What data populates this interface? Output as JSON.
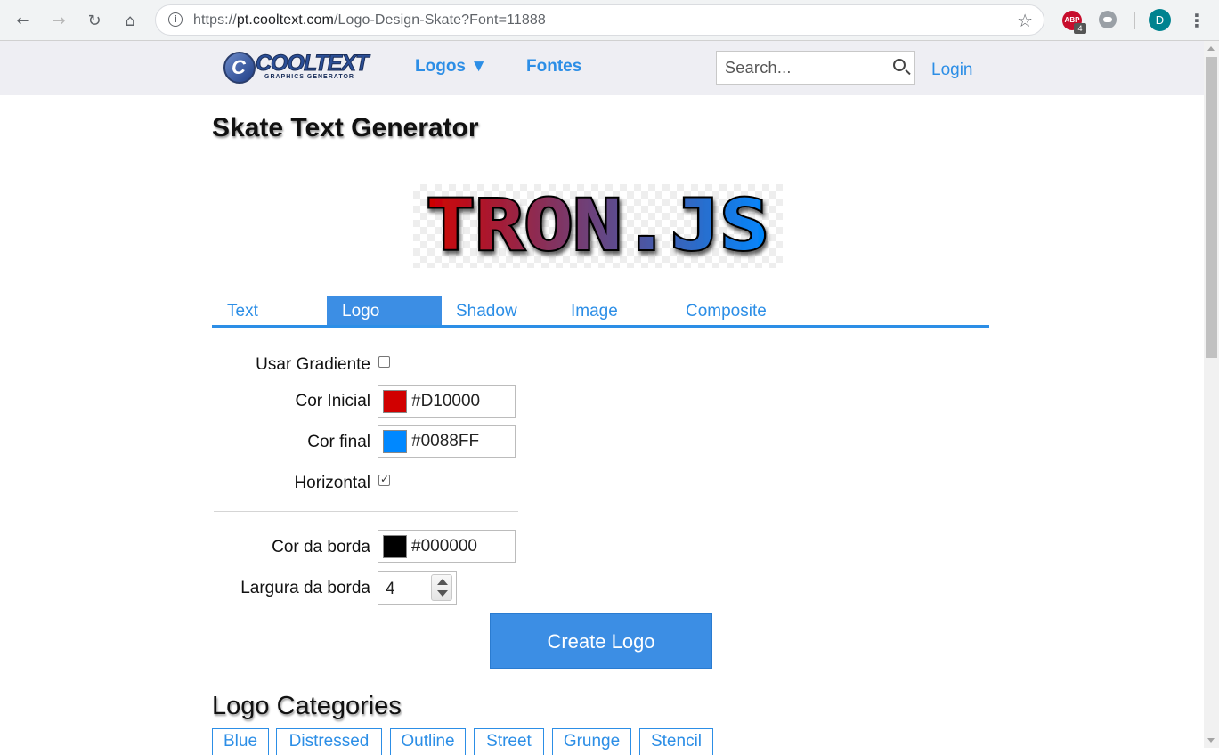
{
  "browser": {
    "url_prefix": "https://",
    "url_host": "pt.cooltext.com",
    "url_path": "/Logo-Design-Skate?Font=11888",
    "back_glyph": "←",
    "forward_glyph": "→",
    "reload_glyph": "↻",
    "home_glyph": "⌂",
    "star_glyph": "☆",
    "info_glyph": "i",
    "abp_label": "ABP",
    "abp_badge": "4",
    "profile_initial": "D",
    "menu_glyph": "⋮"
  },
  "header": {
    "logo_word": "COOLTEXT",
    "logo_sub": "GRAPHICS GENERATOR",
    "logo_mark": "C",
    "nav_logos": "Logos ▼",
    "nav_fonts": "Fontes",
    "search_placeholder": "Search...",
    "login": "Login"
  },
  "page": {
    "title": "Skate Text Generator",
    "preview_text": "TRON.JS"
  },
  "tabs": [
    {
      "label": "Text",
      "active": false
    },
    {
      "label": "Logo",
      "active": true
    },
    {
      "label": "Shadow",
      "active": false
    },
    {
      "label": "Image",
      "active": false
    },
    {
      "label": "Composite",
      "active": false
    }
  ],
  "form": {
    "gradient_label": "Usar Gradiente",
    "gradient_checked": false,
    "start_color_label": "Cor Inicial",
    "start_color": "#D10000",
    "end_color_label": "Cor final",
    "end_color": "#0088FF",
    "horizontal_label": "Horizontal",
    "horizontal_checked": true,
    "border_color_label": "Cor da borda",
    "border_color": "#000000",
    "border_width_label": "Largura da borda",
    "border_width": "4",
    "create_button": "Create Logo"
  },
  "categories": {
    "title": "Logo Categories",
    "items": [
      "Blue",
      "Distressed",
      "Outline",
      "Street",
      "Grunge",
      "Stencil"
    ]
  },
  "colors": {
    "accent": "#2c8ee6",
    "tab_active_bg": "#3c8ee4"
  }
}
